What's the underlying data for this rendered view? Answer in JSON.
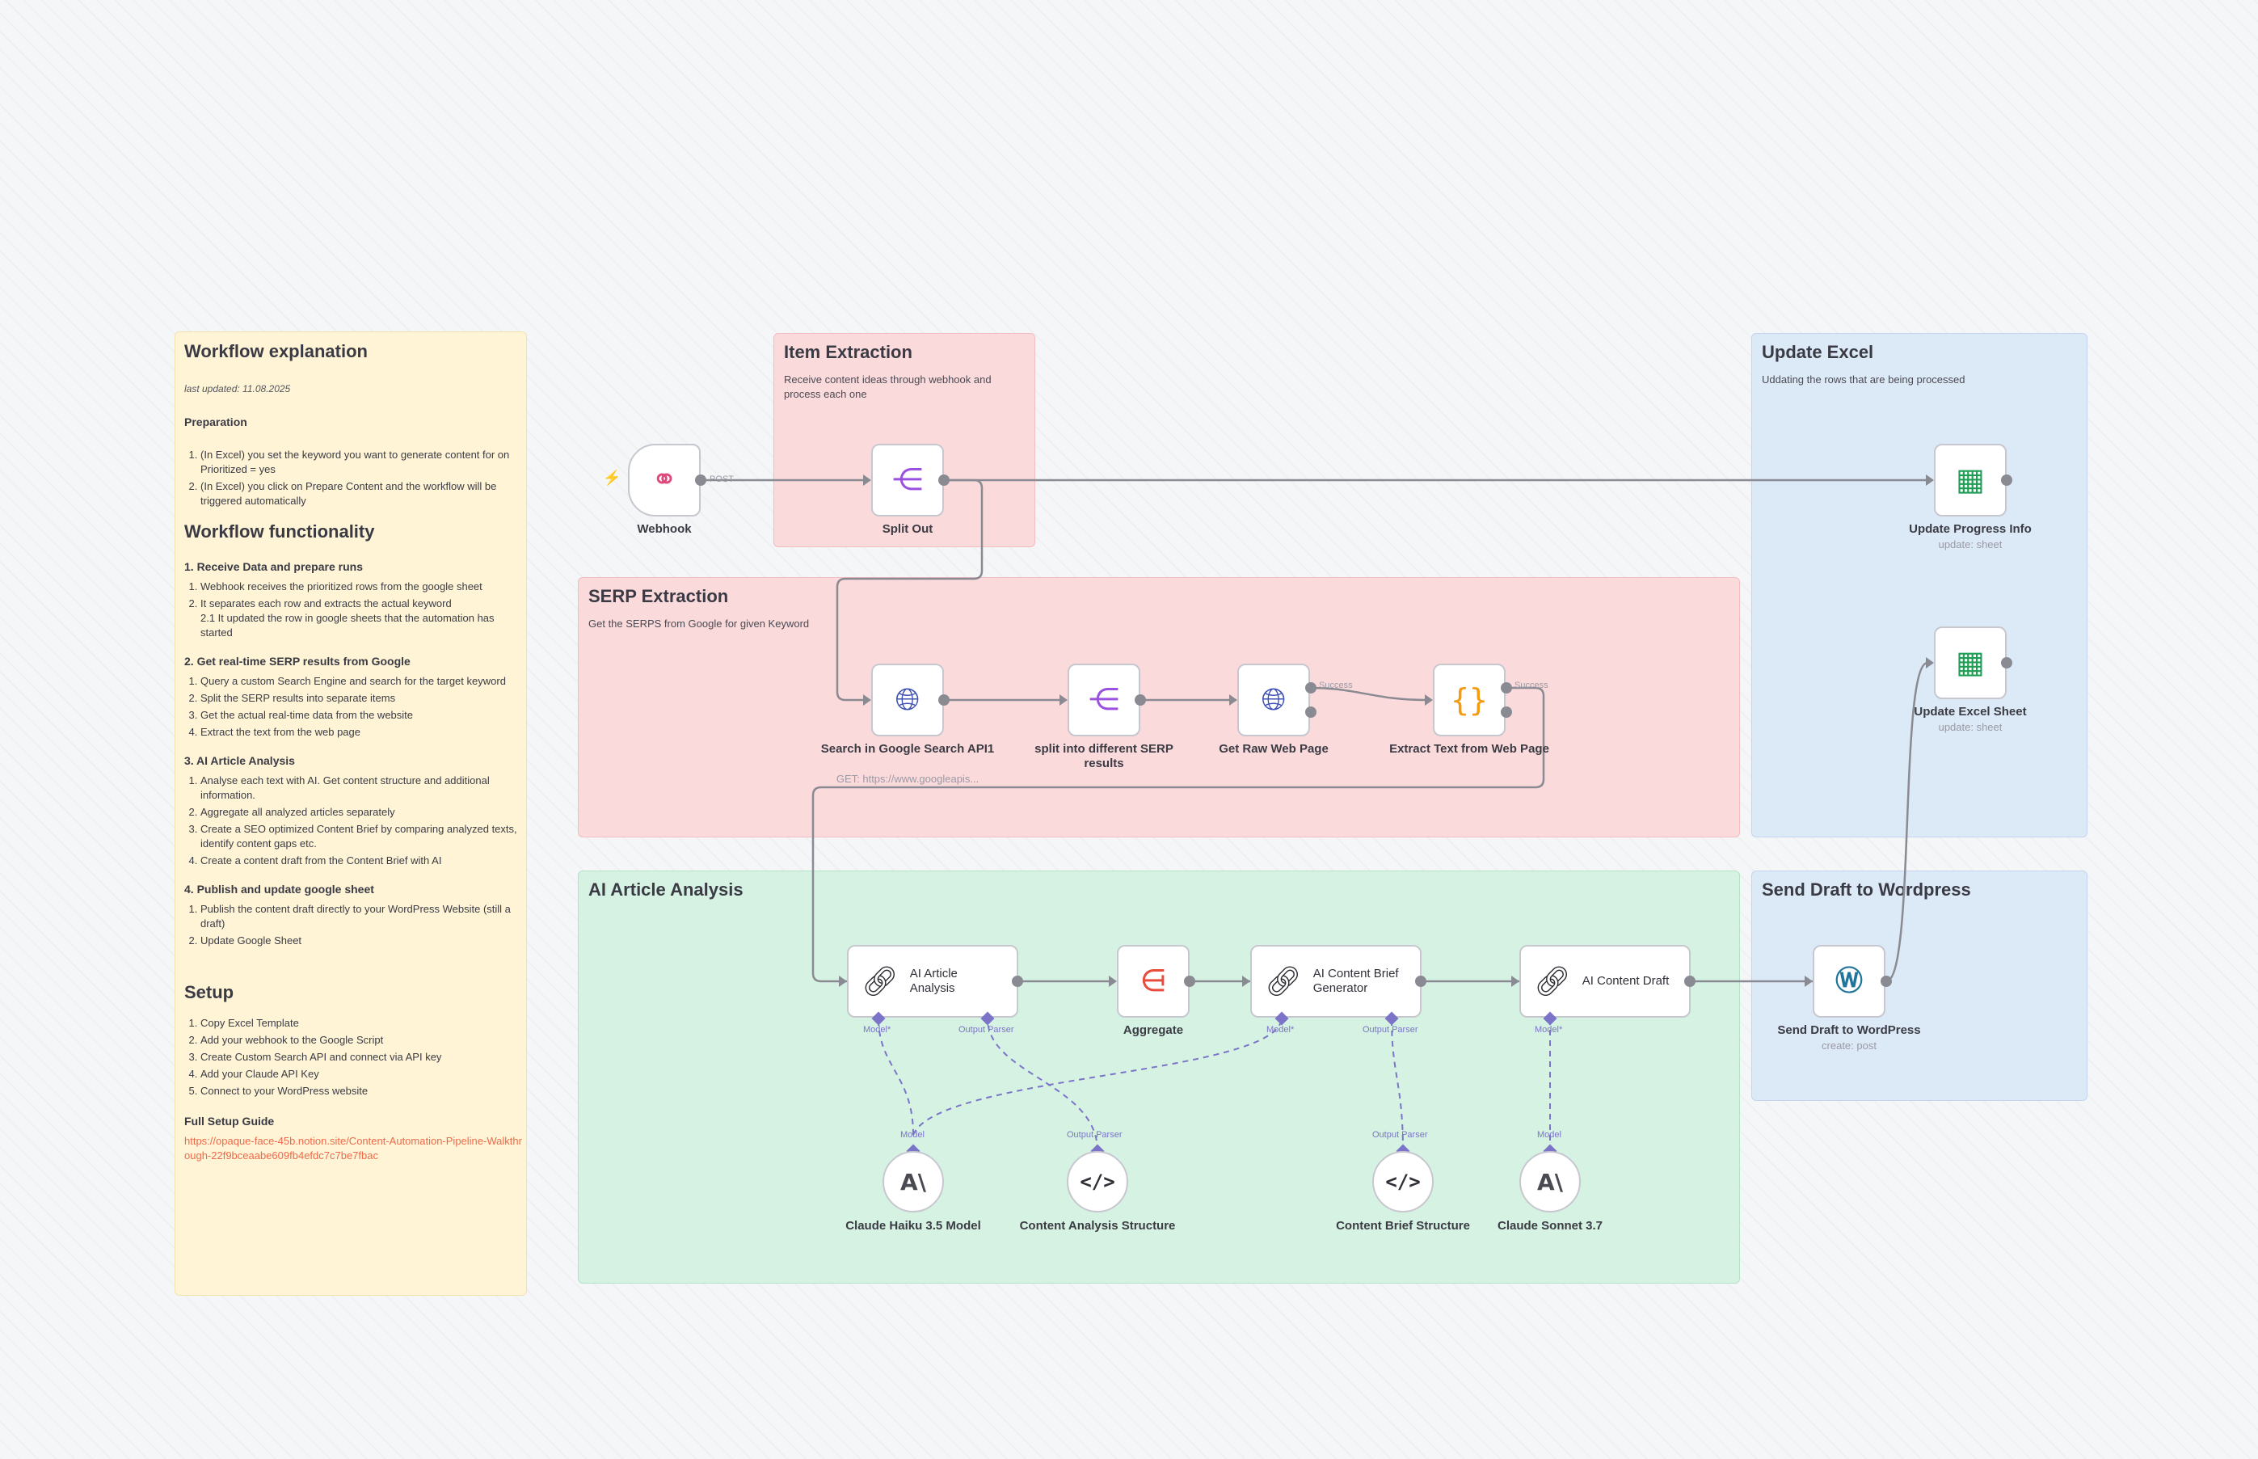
{
  "notes": {
    "explanation": {
      "title": "Workflow explanation",
      "last_updated": "last updated: 11.08.2025",
      "preparation_title": "Preparation",
      "preparation": [
        "(In Excel) you set the keyword you want to generate content for on Prioritized = yes",
        "(In Excel) you click on Prepare Content and the workflow will be triggered automatically"
      ],
      "functionality_title": "Workflow functionality",
      "sections": [
        {
          "title": "1. Receive Data and prepare runs",
          "items": [
            "Webhook receives the prioritized rows from the google sheet",
            "It separates each row and extracts the actual keyword",
            "2.1 It updated the row in google sheets that the automation has started"
          ]
        },
        {
          "title": "2. Get real-time SERP results from Google",
          "items": [
            "Query a custom Search Engine and search for the target keyword",
            "Split the SERP results into separate items",
            "Get the actual real-time data from the website",
            "Extract the text from the web page"
          ]
        },
        {
          "title": "3. AI Article Analysis",
          "items": [
            "Analyse each text with AI. Get content structure and additional information.",
            "Aggregate all analyzed articles separately",
            "Create a SEO optimized Content Brief by comparing analyzed texts, identify content gaps etc.",
            "Create a content draft from the Content Brief with AI"
          ]
        },
        {
          "title": "4. Publish and update google sheet",
          "items": [
            "Publish the content draft directly to your WordPress Website (still a draft)",
            "Update Google Sheet"
          ]
        }
      ],
      "setup_title": "Setup",
      "setup": [
        "Copy Excel Template",
        "Add your webhook to the Google Script",
        "Create Custom Search API and connect via API key",
        "Add your Claude API Key",
        "Connect to your WordPress website"
      ],
      "guide_title": "Full Setup Guide",
      "guide_link": "https://opaque-face-45b.notion.site/Content-Automation-Pipeline-Walkthrough-22f9bceaabe609fb4efdc7c7be7fbac"
    },
    "item_extraction": {
      "title": "Item Extraction",
      "subtitle": "Receive content ideas through webhook and process each one"
    },
    "serp_extraction": {
      "title": "SERP Extraction",
      "subtitle": "Get the SERPS from Google for given Keyword"
    },
    "update_excel": {
      "title": "Update Excel",
      "subtitle": "Uddating the rows that are being processed"
    },
    "ai_article_analysis": {
      "title": "AI Article Analysis"
    },
    "send_draft": {
      "title": "Send Draft to Wordpress"
    }
  },
  "nodes": {
    "webhook": {
      "label": "Webhook",
      "icon": "webhook-icon",
      "edge_label": "POST"
    },
    "split_out": {
      "label": "Split Out",
      "icon": "split-icon"
    },
    "update_progress": {
      "label": "Update Progress Info",
      "sub": "update: sheet",
      "icon": "google-sheets-icon"
    },
    "update_excel_sheet": {
      "label": "Update Excel Sheet",
      "sub": "update: sheet",
      "icon": "google-sheets-icon"
    },
    "search_google": {
      "label": "Search in Google Search API1",
      "sub": "GET: https://www.googleapis...",
      "icon": "globe-icon"
    },
    "split_serp": {
      "label": "split into different SERP results",
      "icon": "split-icon"
    },
    "get_raw": {
      "label": "Get Raw Web Page",
      "icon": "globe-icon",
      "out_label": "Success"
    },
    "extract_text": {
      "label": "Extract Text from Web Page",
      "icon": "code-braces-icon",
      "out_label": "Success"
    },
    "ai_article": {
      "label": "AI Article Analysis",
      "icon": "chain-link-icon",
      "model_label": "Model*",
      "parser_label": "Output Parser"
    },
    "aggregate": {
      "label": "Aggregate",
      "icon": "aggregate-icon"
    },
    "ai_brief": {
      "label": "AI Content Brief Generator",
      "icon": "chain-link-icon",
      "model_label": "Model*",
      "parser_label": "Output Parser"
    },
    "ai_draft": {
      "label": "AI Content Draft",
      "icon": "chain-link-icon",
      "model_label": "Model*"
    },
    "send_wp": {
      "label": "Send Draft to WordPress",
      "sub": "create: post",
      "icon": "wordpress-icon"
    },
    "haiku": {
      "label": "Claude Haiku 3.5 Model",
      "top_label": "Model",
      "glyph": "A\\"
    },
    "analysis_struct": {
      "label": "Content Analysis Structure",
      "top_label": "Output Parser",
      "glyph": "</>"
    },
    "brief_struct": {
      "label": "Content Brief Structure",
      "top_label": "Output Parser",
      "glyph": "</>"
    },
    "sonnet": {
      "label": "Claude Sonnet 3.7",
      "top_label": "Model",
      "glyph": "A\\"
    }
  },
  "colors": {
    "note_yellow": "#fff4d6",
    "note_red": "#fbdadc",
    "note_blue": "#dce9f7",
    "note_green": "#d6f2e3",
    "wire": "#8a8a92",
    "ai_port": "#7b74c8",
    "link": "#ef6a4a"
  }
}
